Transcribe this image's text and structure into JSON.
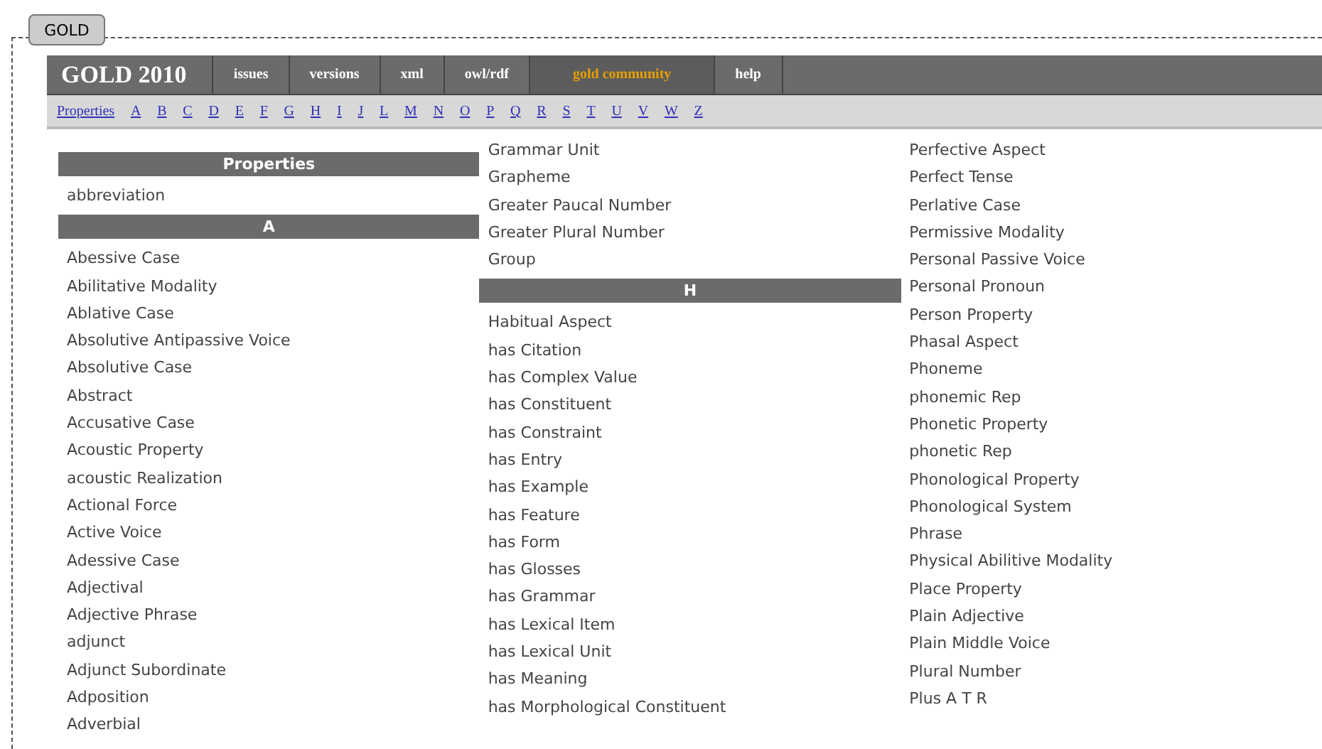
{
  "tab": {
    "label": "GOLD"
  },
  "nav": {
    "title": "GOLD 2010",
    "items": [
      {
        "label": "issues",
        "selected": false
      },
      {
        "label": "versions",
        "selected": false
      },
      {
        "label": "xml",
        "selected": false
      },
      {
        "label": "owl/rdf",
        "selected": false
      },
      {
        "label": "gold community",
        "selected": true
      },
      {
        "label": "help",
        "selected": false
      }
    ]
  },
  "letters": [
    "Properties",
    "A",
    "B",
    "C",
    "D",
    "E",
    "F",
    "G",
    "H",
    "I",
    "J",
    "L",
    "M",
    "N",
    "O",
    "P",
    "Q",
    "R",
    "S",
    "T",
    "U",
    "V",
    "W",
    "Z"
  ],
  "columns": [
    [
      {
        "kind": "header",
        "text": "Properties"
      },
      {
        "kind": "item",
        "text": "abbreviation"
      },
      {
        "kind": "header",
        "text": "A"
      },
      {
        "kind": "item",
        "text": "Abessive Case"
      },
      {
        "kind": "item",
        "text": "Abilitative Modality"
      },
      {
        "kind": "item",
        "text": "Ablative Case"
      },
      {
        "kind": "item",
        "text": "Absolutive Antipassive Voice"
      },
      {
        "kind": "item",
        "text": "Absolutive Case"
      },
      {
        "kind": "item",
        "text": "Abstract"
      },
      {
        "kind": "item",
        "text": "Accusative Case"
      },
      {
        "kind": "item",
        "text": "Acoustic Property"
      },
      {
        "kind": "item",
        "text": "acoustic Realization"
      },
      {
        "kind": "item",
        "text": "Actional Force"
      },
      {
        "kind": "item",
        "text": "Active Voice"
      },
      {
        "kind": "item",
        "text": "Adessive Case"
      },
      {
        "kind": "item",
        "text": "Adjectival"
      },
      {
        "kind": "item",
        "text": "Adjective Phrase"
      },
      {
        "kind": "item",
        "text": "adjunct"
      },
      {
        "kind": "item",
        "text": "Adjunct Subordinate"
      },
      {
        "kind": "item",
        "text": "Adposition"
      },
      {
        "kind": "item",
        "text": "Adverbial"
      }
    ],
    [
      {
        "kind": "item",
        "text": "Grammar Unit"
      },
      {
        "kind": "item",
        "text": "Grapheme"
      },
      {
        "kind": "item",
        "text": "Greater Paucal Number"
      },
      {
        "kind": "item",
        "text": "Greater Plural Number"
      },
      {
        "kind": "item",
        "text": "Group"
      },
      {
        "kind": "header",
        "text": "H"
      },
      {
        "kind": "item",
        "text": "Habitual Aspect"
      },
      {
        "kind": "item",
        "text": "has Citation"
      },
      {
        "kind": "item",
        "text": "has Complex Value"
      },
      {
        "kind": "item",
        "text": "has Constituent"
      },
      {
        "kind": "item",
        "text": "has Constraint"
      },
      {
        "kind": "item",
        "text": "has Entry"
      },
      {
        "kind": "item",
        "text": "has Example"
      },
      {
        "kind": "item",
        "text": "has Feature"
      },
      {
        "kind": "item",
        "text": "has Form"
      },
      {
        "kind": "item",
        "text": "has Glosses"
      },
      {
        "kind": "item",
        "text": "has Grammar"
      },
      {
        "kind": "item",
        "text": "has Lexical Item"
      },
      {
        "kind": "item",
        "text": "has Lexical Unit"
      },
      {
        "kind": "item",
        "text": "has Meaning"
      },
      {
        "kind": "item",
        "text": "has Morphological Constituent"
      }
    ],
    [
      {
        "kind": "item",
        "text": "Perfective Aspect"
      },
      {
        "kind": "item",
        "text": "Perfect Tense"
      },
      {
        "kind": "item",
        "text": "Perlative Case"
      },
      {
        "kind": "item",
        "text": "Permissive Modality"
      },
      {
        "kind": "item",
        "text": "Personal Passive Voice"
      },
      {
        "kind": "item",
        "text": "Personal Pronoun"
      },
      {
        "kind": "item",
        "text": "Person Property"
      },
      {
        "kind": "item",
        "text": "Phasal Aspect"
      },
      {
        "kind": "item",
        "text": "Phoneme"
      },
      {
        "kind": "item",
        "text": "phonemic Rep"
      },
      {
        "kind": "item",
        "text": "Phonetic Property"
      },
      {
        "kind": "item",
        "text": "phonetic Rep"
      },
      {
        "kind": "item",
        "text": "Phonological Property"
      },
      {
        "kind": "item",
        "text": "Phonological System"
      },
      {
        "kind": "item",
        "text": "Phrase"
      },
      {
        "kind": "item",
        "text": "Physical Abilitive Modality"
      },
      {
        "kind": "item",
        "text": "Place Property"
      },
      {
        "kind": "item",
        "text": "Plain Adjective"
      },
      {
        "kind": "item",
        "text": "Plain Middle Voice"
      },
      {
        "kind": "item",
        "text": "Plural Number"
      },
      {
        "kind": "item",
        "text": "Plus A T R"
      }
    ]
  ]
}
